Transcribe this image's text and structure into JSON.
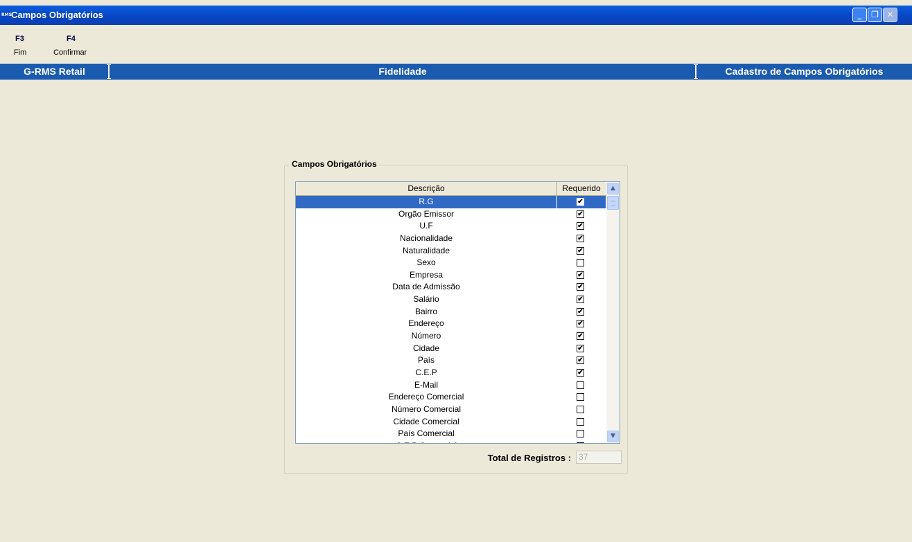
{
  "window": {
    "title": "Campos Obrigatórios",
    "icon_text": "RMS"
  },
  "toolbar": {
    "keys": [
      {
        "key": "F3",
        "label": "Fim"
      },
      {
        "key": "F4",
        "label": "Confirmar"
      }
    ]
  },
  "header": {
    "left": "G-RMS Retail",
    "middle": "Fidelidade",
    "right": "Cadastro de Campos Obrigatórios"
  },
  "group": {
    "title": "Campos Obrigatórios"
  },
  "grid": {
    "columns": [
      "Descrição",
      "Requerido"
    ],
    "rows": [
      {
        "descricao": "R.G",
        "requerido": true,
        "selected": true
      },
      {
        "descricao": "Orgão Emissor",
        "requerido": true
      },
      {
        "descricao": "U.F",
        "requerido": true
      },
      {
        "descricao": "Nacionalidade",
        "requerido": true
      },
      {
        "descricao": "Naturalidade",
        "requerido": true
      },
      {
        "descricao": "Sexo",
        "requerido": false
      },
      {
        "descricao": "Empresa",
        "requerido": true
      },
      {
        "descricao": "Data de Admissão",
        "requerido": true
      },
      {
        "descricao": "Salário",
        "requerido": true
      },
      {
        "descricao": "Bairro",
        "requerido": true
      },
      {
        "descricao": "Endereço",
        "requerido": true
      },
      {
        "descricao": "Número",
        "requerido": true
      },
      {
        "descricao": "Cidade",
        "requerido": true
      },
      {
        "descricao": "País",
        "requerido": true
      },
      {
        "descricao": "C.E.P",
        "requerido": true
      },
      {
        "descricao": "E-Mail",
        "requerido": false
      },
      {
        "descricao": "Endereço Comercial",
        "requerido": false
      },
      {
        "descricao": "Número Comercial",
        "requerido": false
      },
      {
        "descricao": "Cidade Comercial",
        "requerido": false
      },
      {
        "descricao": "País Comercial",
        "requerido": false
      },
      {
        "descricao": "C.E.P Comercial",
        "requerido": false
      }
    ]
  },
  "footer": {
    "total_label": "Total de Registros :",
    "total_value": "37"
  },
  "icons": {
    "minimize": "minimize-icon",
    "restore": "restore-icon",
    "close": "close-icon",
    "scroll_up": "chevron-up-icon",
    "scroll_down": "chevron-down-icon",
    "check": "check-icon"
  }
}
